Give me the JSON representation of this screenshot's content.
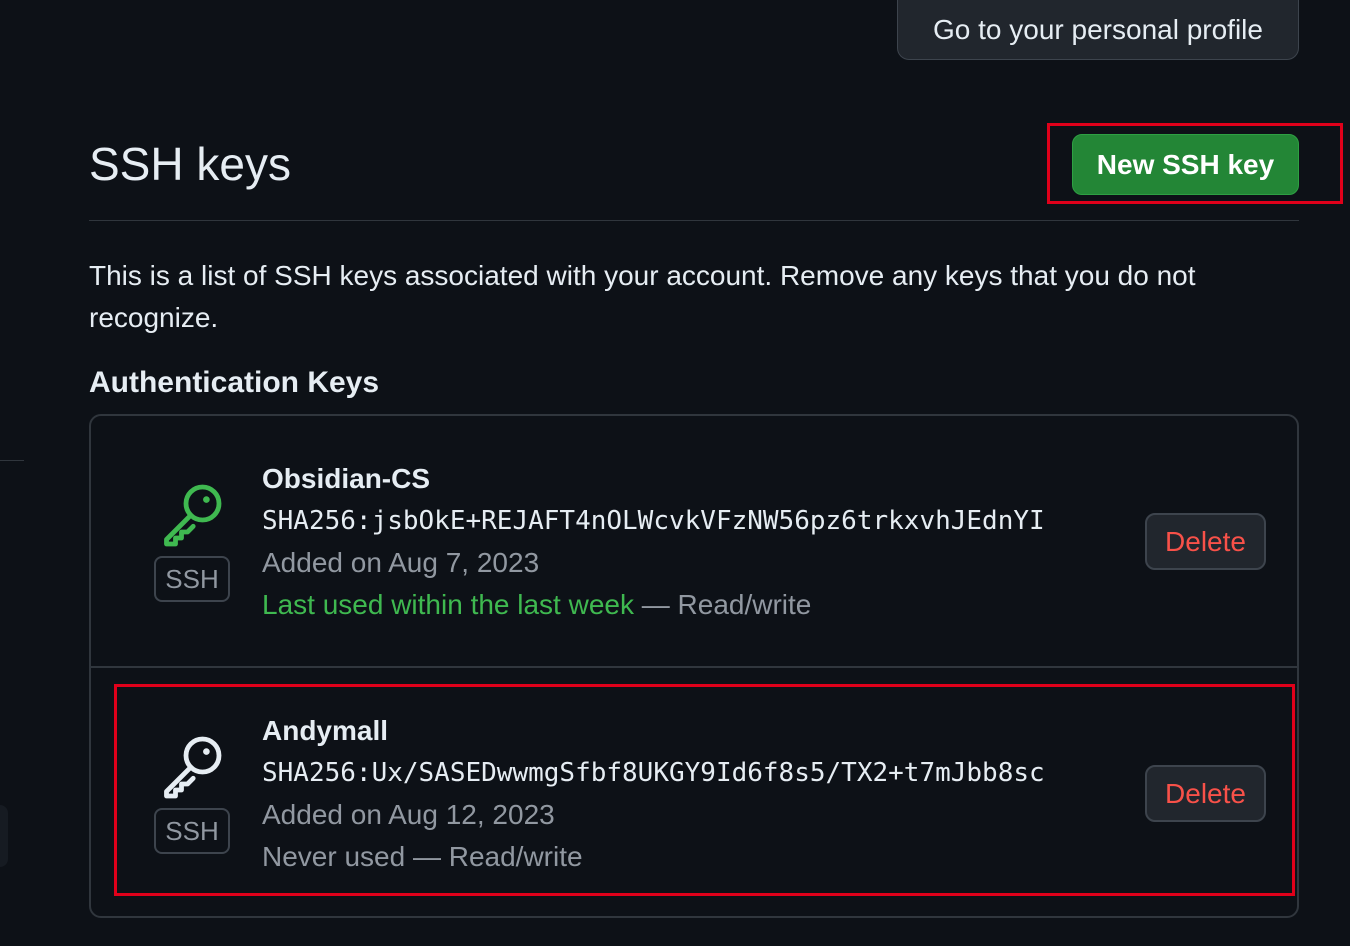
{
  "header": {
    "profile_button": "Go to your personal profile"
  },
  "page": {
    "title": "SSH keys",
    "new_button": "New SSH key",
    "description": "This is a list of SSH keys associated with your account. Remove any keys that you do not recognize.",
    "section_title": "Authentication Keys"
  },
  "keys": [
    {
      "icon": "key-icon",
      "icon_color": "#3fb950",
      "badge": "SSH",
      "name": "Obsidian-CS",
      "fingerprint": "SHA256:jsbOkE+REJAFT4nOLWcvkVFzNW56pz6trkxvhJEdnYI",
      "added": "Added on Aug 7, 2023",
      "last_used": "Last used within the last week",
      "access": " — Read/write",
      "delete_label": "Delete"
    },
    {
      "icon": "key-icon",
      "icon_color": "#e6edf3",
      "badge": "SSH",
      "name": "Andymall",
      "fingerprint": "SHA256:Ux/SASEDwwmgSfbf8UKGY9Id6f8s5/TX2+t7mJbb8sc",
      "added": "Added on Aug 12, 2023",
      "usage": "Never used — Read/write",
      "delete_label": "Delete"
    }
  ],
  "colors": {
    "background": "#0d1117",
    "primary_button": "#238636",
    "danger_text": "#f85149",
    "success_text": "#3fb950",
    "highlight_outline": "#e0001a"
  }
}
